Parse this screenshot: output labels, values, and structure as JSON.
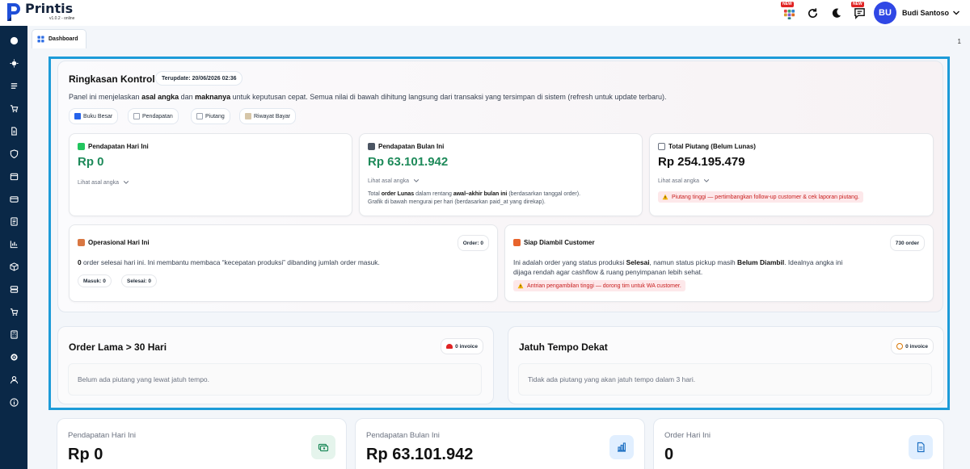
{
  "app": {
    "name": "Printis",
    "version": "v1.0.2 - online"
  },
  "header": {
    "new_badge": "NEW",
    "user": {
      "initials": "BU",
      "name": "Budi Santoso"
    }
  },
  "tabs": {
    "active_label": "Dashboard",
    "page_number": "1"
  },
  "summary": {
    "title": "Ringkasan Kontrol",
    "updated": "Terupdate: 20/06/2026 02:36",
    "desc_1": "Panel ini menjelaskan ",
    "desc_b1": "asal angka",
    "desc_2": " dan ",
    "desc_b2": "maknanya",
    "desc_3": " untuk keputusan cepat. Semua nilai di bawah dihitung langsung dari transaksi yang tersimpan di sistem (refresh untuk update terbaru).",
    "links": [
      "Buku Besar",
      "Pendapatan",
      "Piutang",
      "Riwayat Bayar"
    ],
    "see_origin": "Lihat asal angka",
    "today": {
      "title": "Pendapatan Hari Ini",
      "value": "Rp 0"
    },
    "month": {
      "title": "Pendapatan Bulan Ini",
      "value": "Rp 63.101.942",
      "note_1": "Total ",
      "note_b1": "order Lunas",
      "note_2": " dalam rentang ",
      "note_b2": "awal–akhir bulan ini",
      "note_3": " (berdasarkan tanggal order).",
      "note_line2": "Grafik di bawah mengurai per hari (berdasarkan paid_at yang direkap)."
    },
    "receivable": {
      "title": "Total Piutang (Belum Lunas)",
      "value": "Rp 254.195.479",
      "warning": "Piutang tinggi — pertimbangkan follow-up customer & cek laporan piutang."
    },
    "operational": {
      "title": "Operasional Hari Ini",
      "badge": "Order: 0",
      "text_b": "0",
      "text": " order selesai hari ini. Ini membantu membaca “kecepatan produksi” dibanding jumlah order masuk.",
      "in_label": "Masuk: 0",
      "done_label": "Selesai: 0"
    },
    "pickup": {
      "title": "Siap Diambil Customer",
      "badge": "730 order",
      "text_1": "Ini adalah order yang status produksi ",
      "text_b1": "Selesai",
      "text_2": ", namun status pickup masih ",
      "text_b2": "Belum Diambil",
      "text_3": ". Idealnya angka ini",
      "text_line2": "dijaga rendah agar cashflow & ruang penyimpanan lebih sehat.",
      "warning": "Antrian pengambilan tinggi — dorong tim untuk WA customer."
    }
  },
  "old_orders": {
    "title": "Order Lama > 30 Hari",
    "badge": "0 invoice",
    "empty": "Belum ada piutang yang lewat jatuh tempo."
  },
  "due_soon": {
    "title": "Jatuh Tempo Dekat",
    "badge": "0 invoice",
    "empty": "Tidak ada piutang yang akan jatuh tempo dalam 3 hari."
  },
  "stats": [
    {
      "label": "Pendapatan Hari Ini",
      "value": "Rp 0"
    },
    {
      "label": "Pendapatan Bulan Ini",
      "value": "Rp 63.101.942"
    },
    {
      "label": "Order Hari Ini",
      "value": "0"
    }
  ],
  "colors": {
    "sidebar": "#0a2847",
    "accent": "#2f47e5",
    "positive": "#1e8a5a",
    "danger": "#c81e1e",
    "highlight": "#1c9bd8"
  }
}
